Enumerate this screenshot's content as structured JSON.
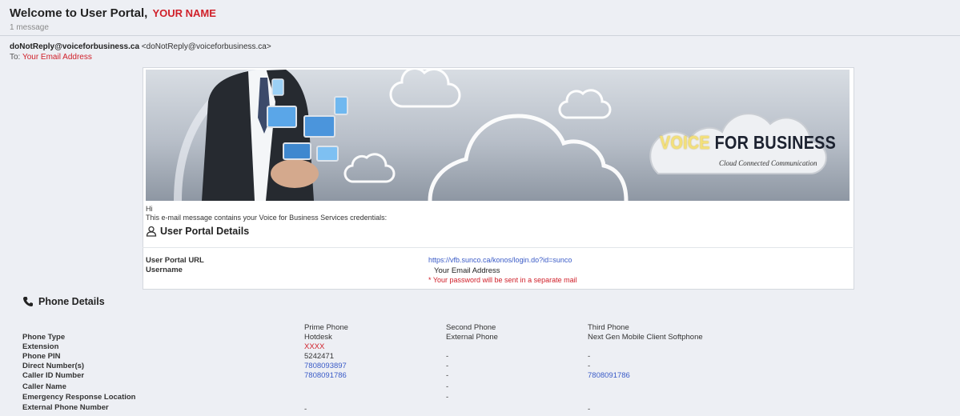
{
  "email": {
    "subject": "Welcome to User Portal,",
    "subject_name": "YOUR NAME",
    "message_count": "1 message",
    "from_name": "doNotReply@voiceforbusiness.ca",
    "from_address": "<doNotReply@voiceforbusiness.ca>",
    "to_label": "To:",
    "to_value": "Your Email Address"
  },
  "banner": {
    "logo_highlight": "VOICE",
    "logo_rest": " FOR BUSINESS",
    "tagline": "Cloud Connected Communication"
  },
  "body": {
    "greeting": "Hi",
    "intro": "This e-mail message contains your Voice for Business Services credentials:",
    "portal_section_title": "User Portal Details",
    "portal_url_label": "User Portal URL",
    "portal_url_value": "https://vfb.sunco.ca/konos/login.do?id=sunco",
    "username_label": "Username",
    "username_value": "Your Email Address",
    "password_note": "* Your password will be sent in a separate mail"
  },
  "phone": {
    "section_title": "Phone Details",
    "columns": [
      "Prime Phone",
      "Second Phone",
      "Third Phone"
    ],
    "rows": [
      {
        "label": "Phone Type",
        "cells": [
          "Hotdesk",
          "External Phone",
          "Next Gen Mobile Client Softphone"
        ]
      },
      {
        "label": "Extension",
        "cells": [
          "XXXX",
          "",
          ""
        ]
      },
      {
        "label": "Phone PIN",
        "cells": [
          "5242471",
          "-",
          "-"
        ]
      },
      {
        "label": "Direct Number(s)",
        "cells": [
          "7808093897",
          "-",
          "-"
        ]
      },
      {
        "label": "Caller ID Number",
        "cells": [
          "7808091786",
          "-",
          "7808091786"
        ]
      },
      {
        "label": "Caller Name",
        "cells": [
          "",
          "-",
          ""
        ]
      },
      {
        "label": "Emergency Response Location",
        "cells": [
          "",
          "-",
          ""
        ]
      },
      {
        "label": "External Phone Number",
        "cells": [
          "-",
          "",
          "-"
        ]
      }
    ]
  },
  "colors": {
    "accent_red": "#d0202a",
    "link_blue": "#3a5bc7",
    "background": "#edeff4"
  }
}
